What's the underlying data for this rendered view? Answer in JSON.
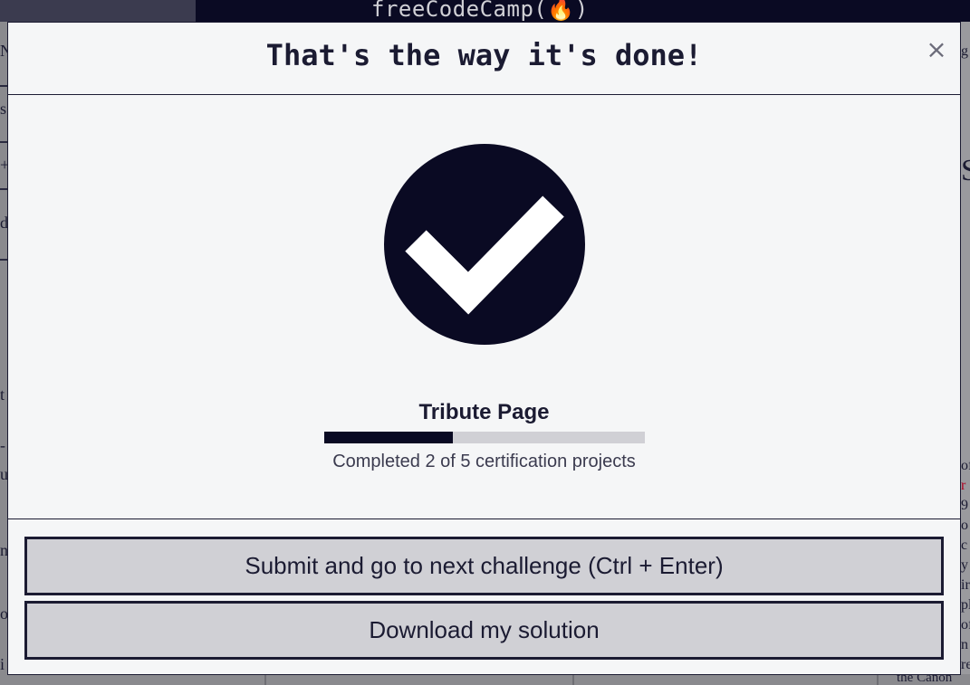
{
  "background": {
    "logo": "freeCodeCamp(🔥)",
    "left_fragments": [
      "N",
      "s",
      "+",
      "d",
      "t",
      "-",
      "u",
      "n",
      "of",
      "i"
    ],
    "right_fragments": [
      "g",
      "S",
      "of",
      "r",
      "9",
      "o",
      "c",
      "y",
      "ir",
      "pl",
      "of",
      "n",
      "re"
    ],
    "bottom_fragment": "the Canon"
  },
  "modal": {
    "title": "That's the way it's done!",
    "close_label": "×",
    "project_title": "Tribute Page",
    "progress": {
      "completed": 2,
      "total": 5,
      "fraction": 0.4
    },
    "progress_text": "Completed 2 of 5 certification projects",
    "submit_button": "Submit and go to next challenge (Ctrl + Enter)",
    "download_button": "Download my solution"
  },
  "colors": {
    "primary": "#0a0a23",
    "modal_background": "#f5f6f7",
    "button_background": "#d0d0d5"
  },
  "icons": {
    "check": "check-circle-icon",
    "close": "close-icon"
  }
}
